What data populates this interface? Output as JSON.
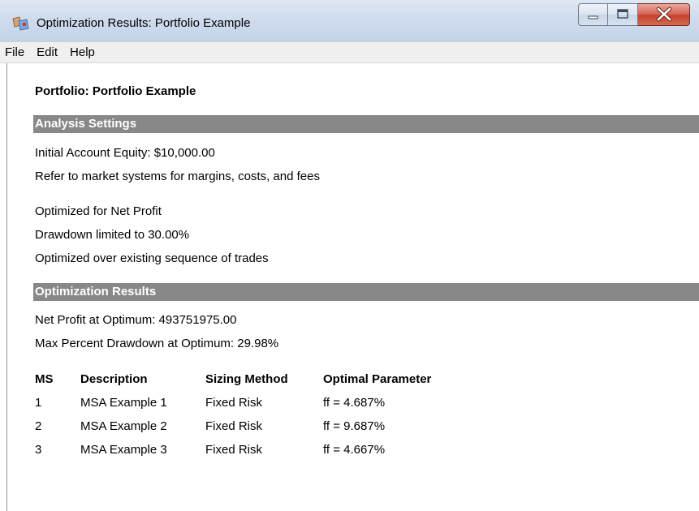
{
  "window": {
    "title": "Optimization Results: Portfolio Example"
  },
  "menu": {
    "items": [
      {
        "label": "File"
      },
      {
        "label": "Edit"
      },
      {
        "label": "Help"
      }
    ]
  },
  "report": {
    "portfolio_title": "Portfolio: Portfolio Example",
    "analysis_settings": {
      "heading": "Analysis Settings",
      "initial_equity": "Initial Account Equity: $10,000.00",
      "margins_note": "Refer to market systems for margins, costs, and fees",
      "optimized_for": "Optimized for Net Profit",
      "drawdown_limit": "Drawdown limited to 30.00%",
      "trade_sequence": "Optimized over existing sequence of trades"
    },
    "optimization_results": {
      "heading": "Optimization Results",
      "net_profit": "Net Profit at Optimum: 493751975.00",
      "max_drawdown": "Max Percent Drawdown at Optimum: 29.98%"
    },
    "table": {
      "headers": {
        "ms": "MS",
        "description": "Description",
        "sizing_method": "Sizing Method",
        "optimal_parameter": "Optimal Parameter"
      },
      "rows": [
        {
          "ms": "1",
          "description": "MSA Example 1",
          "sizing_method": "Fixed Risk",
          "optimal_parameter": "ff = 4.687%"
        },
        {
          "ms": "2",
          "description": "MSA Example 2",
          "sizing_method": "Fixed Risk",
          "optimal_parameter": "ff = 9.687%"
        },
        {
          "ms": "3",
          "description": "MSA Example 3",
          "sizing_method": "Fixed Risk",
          "optimal_parameter": "ff = 4.667%"
        }
      ]
    }
  },
  "icons": {
    "app": "app-icon",
    "minimize": "minimize-icon",
    "maximize": "maximize-icon",
    "close": "close-icon"
  }
}
